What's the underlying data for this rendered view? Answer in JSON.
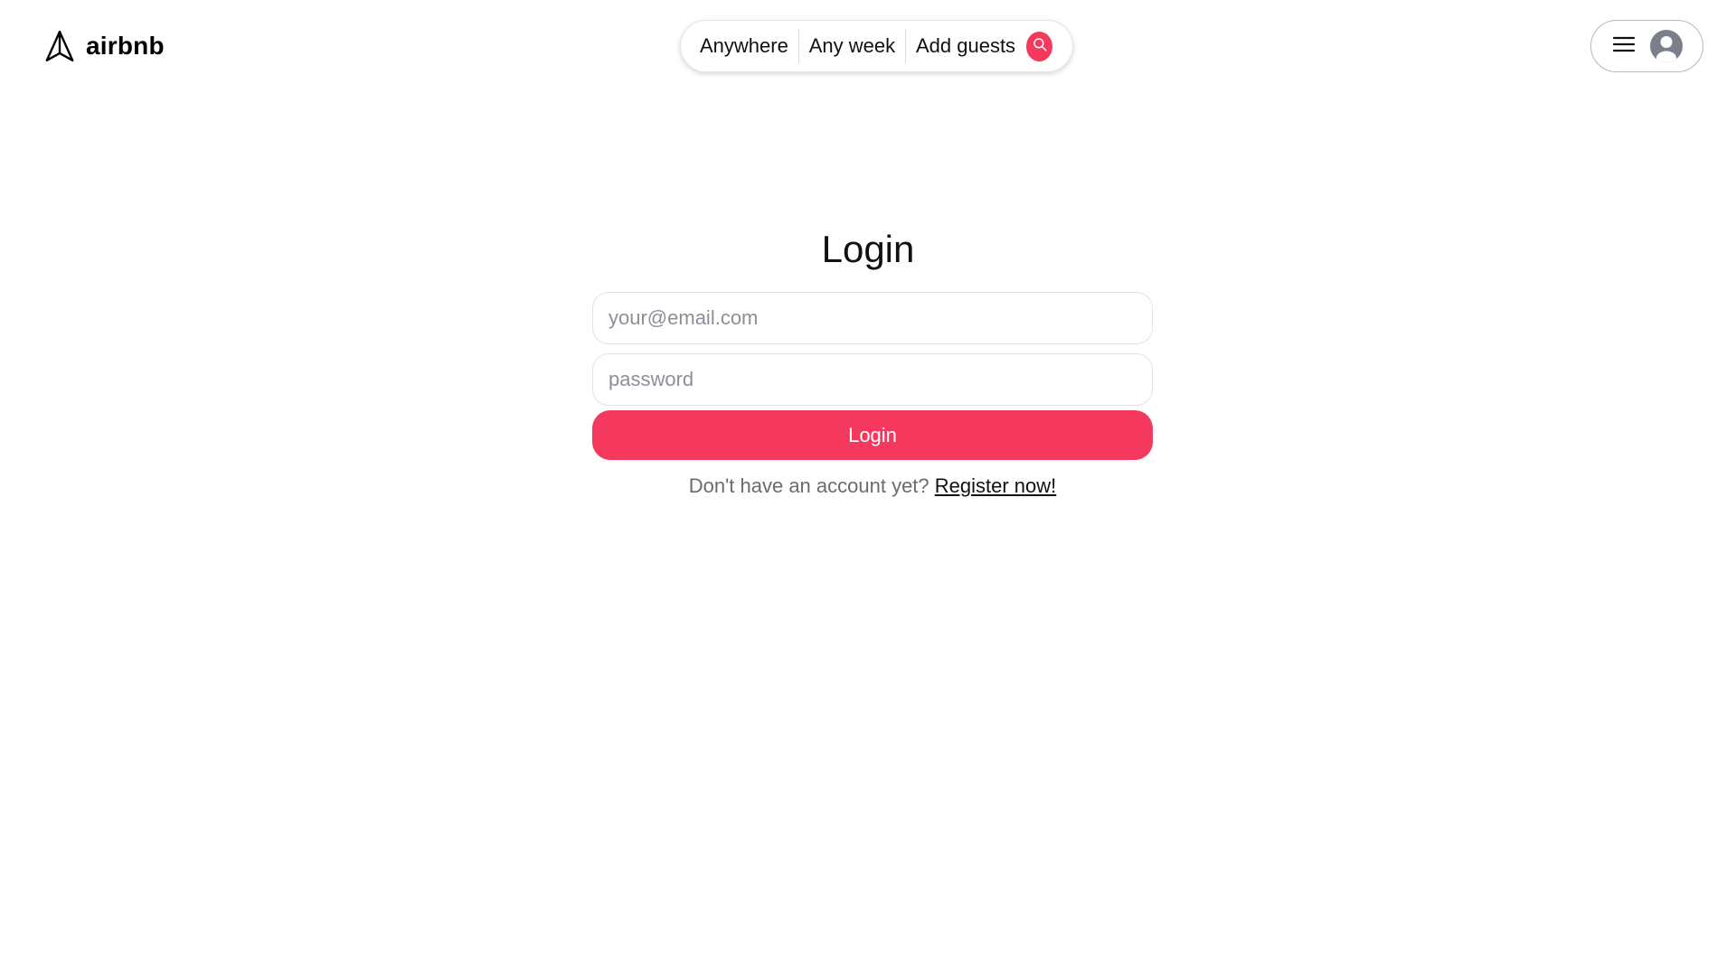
{
  "header": {
    "logo_text": "airbnb",
    "search": {
      "where_label": "Anywhere",
      "when_label": "Any week",
      "who_label": "Add guests"
    }
  },
  "main": {
    "title": "Login",
    "email_placeholder": "your@email.com",
    "password_placeholder": "password",
    "login_button_label": "Login",
    "register_prompt": "Don't have an account yet? ",
    "register_link_label": "Register now!"
  },
  "icons": {
    "logo": "paper-plane-icon",
    "search": "search-icon",
    "menu": "hamburger-menu-icon",
    "avatar": "user-avatar-icon"
  },
  "colors": {
    "accent": "#F5385D",
    "avatar_gray": "#7B7F8A"
  }
}
